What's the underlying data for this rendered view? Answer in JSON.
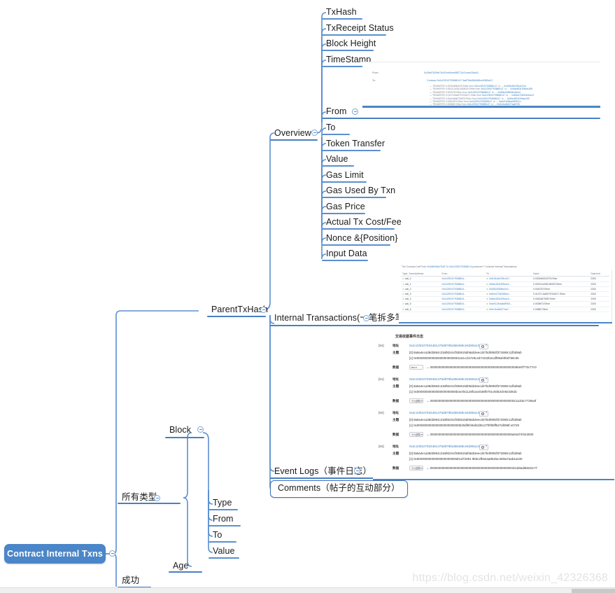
{
  "root": {
    "label": "Contract Internal Txns",
    "color": "#4a86c8"
  },
  "branches": {
    "all_types": {
      "label": "所有类型"
    },
    "success": {
      "label": "成功"
    },
    "block": {
      "label": "Block"
    },
    "age": {
      "label": "Age"
    },
    "parent_tx_hash": {
      "label": "ParentTxHash"
    }
  },
  "block_children": [
    {
      "label": "Type"
    },
    {
      "label": "From"
    },
    {
      "label": "To"
    },
    {
      "label": "Value"
    }
  ],
  "parent_children": [
    {
      "label": "Overview"
    },
    {
      "label": "Internal Transactions(一笔拆多笔)"
    },
    {
      "label": "Event Logs（事件日志）"
    },
    {
      "label": "Comments（帖子的互动部分）"
    }
  ],
  "overview_children": [
    {
      "label": "TxHash"
    },
    {
      "label": "TxReceipt Status"
    },
    {
      "label": "Block Height"
    },
    {
      "label": "TimeStamp"
    },
    {
      "label": "From"
    },
    {
      "label": "To"
    },
    {
      "label": "Token Transfer"
    },
    {
      "label": "Value"
    },
    {
      "label": "Gas Limit"
    },
    {
      "label": "Gas Used By Txn"
    },
    {
      "label": "Gas Price"
    },
    {
      "label": "Actual Tx Cost/Fee"
    },
    {
      "label": "Nonce &{Position}"
    },
    {
      "label": "Input Data"
    }
  ],
  "shot_from": {
    "from_label": "From:",
    "from_value": "0x2fe6762f9e7b2d7ee6cee6f8771a7ccee03ddc3",
    "to_label": "To:",
    "contract_prefix": "Contract",
    "contract_value": "0x2c23910793688147 5a879fa366468ce5380a13",
    "transfers": [
      {
        "amount": "0.002546f3a025 Ether from",
        "from": "0x2c23910793688147",
        "to": "0x4f18c8a728c2d7c6"
      },
      {
        "amount": "0.000214436105052f3 Ether from",
        "from": "0x2c23910793688147",
        "to": "0x5de4831f29bac265"
      },
      {
        "amount": "0.00437f3 Ether from",
        "from": "0x2c23910793688147",
        "to": "0x308e266908ed2e44"
      },
      {
        "amount": "0.0137344a57f7024671 Ether from",
        "from": "0x2c23910793688147",
        "to": "0x60ed726043ebcc2f"
      },
      {
        "amount": "0.00a2a6b8706875 Ether from",
        "from": "0x2c23910793688147",
        "to": "0x5de4831f29bac265"
      },
      {
        "amount": "0.0282df73 Ether from",
        "from": "0x2c23910793688147",
        "to": "0xdef12b8da080941c"
      },
      {
        "amount": "0.008882 Ether from",
        "from": "0x2c23910793688147",
        "to": "0x0e1bc8d227aa6705"
      }
    ]
  },
  "shot_itx": {
    "caption_pre": "The Contract Call From",
    "caption_addr1": "0x0d4f438a7f2d3",
    "caption_mid": "To",
    "caption_addr2": "0x2c23910793688 14",
    "caption_post": "produced 7 Contract Internal Transactions",
    "columns": [
      "Type_TraceAddress",
      "From",
      "To",
      "Value",
      "GasLimit"
    ],
    "rows": [
      {
        "type": "call_0",
        "from": "0x2c2391079368814...",
        "to": "0x4f18c8a728c2d7...",
        "value": "0.002546f3437f3 Ether",
        "gas": "2300"
      },
      {
        "type": "call_1",
        "from": "0x2c2391079368814...",
        "to": "0x5de4831f29bac2...",
        "value": "0.00021443810502f3 Ether",
        "gas": "2300"
      },
      {
        "type": "call_2",
        "from": "0x2c2391079368814...",
        "to": "0x30826908ed241...",
        "value": "0.00437f3 Ether",
        "gas": "2300"
      },
      {
        "type": "call_3",
        "from": "0x2c2391079368814...",
        "to": "0xd0ed72601f8dcc...",
        "value": "0.01373 4a657f7024671 Ether",
        "gas": "2300"
      },
      {
        "type": "call_4",
        "from": "0x2c2391079368814...",
        "to": "0x5de4831f29bac2...",
        "value": "0.0062d8798f3 Ether",
        "gas": "2300"
      },
      {
        "type": "call_5",
        "from": "0x2c2391079368814...",
        "to": "0x4e612b0da08906...",
        "value": "0.0008f73 Ether",
        "gas": "2300"
      },
      {
        "type": "call_6",
        "from": "0x2c2391079368814...",
        "to": "0x0e1bc8d227aa7...",
        "value": "0.00882 Ether",
        "gas": "2300"
      }
    ]
  },
  "shot_logs": {
    "title": "交易收据事件日志",
    "addr_key": "地址",
    "topics_key": "主题",
    "data_key": "数据",
    "entries": [
      {
        "index": "[94]",
        "address": "0x2c239107934481475d879fa366468ce5380a13",
        "topic0": "[0]  8a5a4eca38d2864c23af82c6cf383615d06ab3eecd47bd0993f372690c11fbd9ab",
        "topic1": "[1]  0x0000000000000000000000001161ccfa729c2d7c022b2caff09af4f6d769c05",
        "format": "hex",
        "data": "→ 0000000000000000000000000000000000000000000000000090e0f770c77c0"
      },
      {
        "index": "[91]",
        "address": "0x2c239107934481475d879fa366468ce5380a13",
        "topic0": "[0]  8a5a4eca38d2864c23af82c6cf383615d06ab3eecd47bd0993f372690c11fbd9ab",
        "topic1": "[1]  0x00000000000000000000000b4e4f41128fcae2036f0701c6053cfe924391b",
        "format": "十六进制",
        "data": "→ 0000000000000000000000000000000000000000000000000211dc6c7729a4f"
      },
      {
        "index": "[92]",
        "address": "0x2c239107934481475d879fa366468ce5380a13",
        "topic0": "[0]  8a5a4eca38d2864c23af82c6cf383615d06ab3eecd47bd0993f372690c11fbd9ab",
        "topic1": "[1]  0x0000000000000000000000000b29df5f49af2d35c27f0f08ff527af089f.e0729",
        "format": "十六进制",
        "data": "→ 000000000000000000000000000000000000000000000006a94d74f443000"
      },
      {
        "index": "[93]",
        "address": "0x2c239107934481475d879fa366468ce5380a13",
        "topic0": "[0]  8a5a4eca38d2864c23af82c6cf383615d06ab3eecd47bd0993f372690c11fbd9ab",
        "topic1": "[1]  0x00000000000000000000000d0cd72091 9b9c2fb52aa9b4bec506a7aab4a230",
        "format": "十六进制",
        "data": "→ 00000000000000000000000000000000000000000000000033cd8ad5b633c77"
      }
    ]
  },
  "watermark": "https://blog.csdn.net/weixin_42326368"
}
